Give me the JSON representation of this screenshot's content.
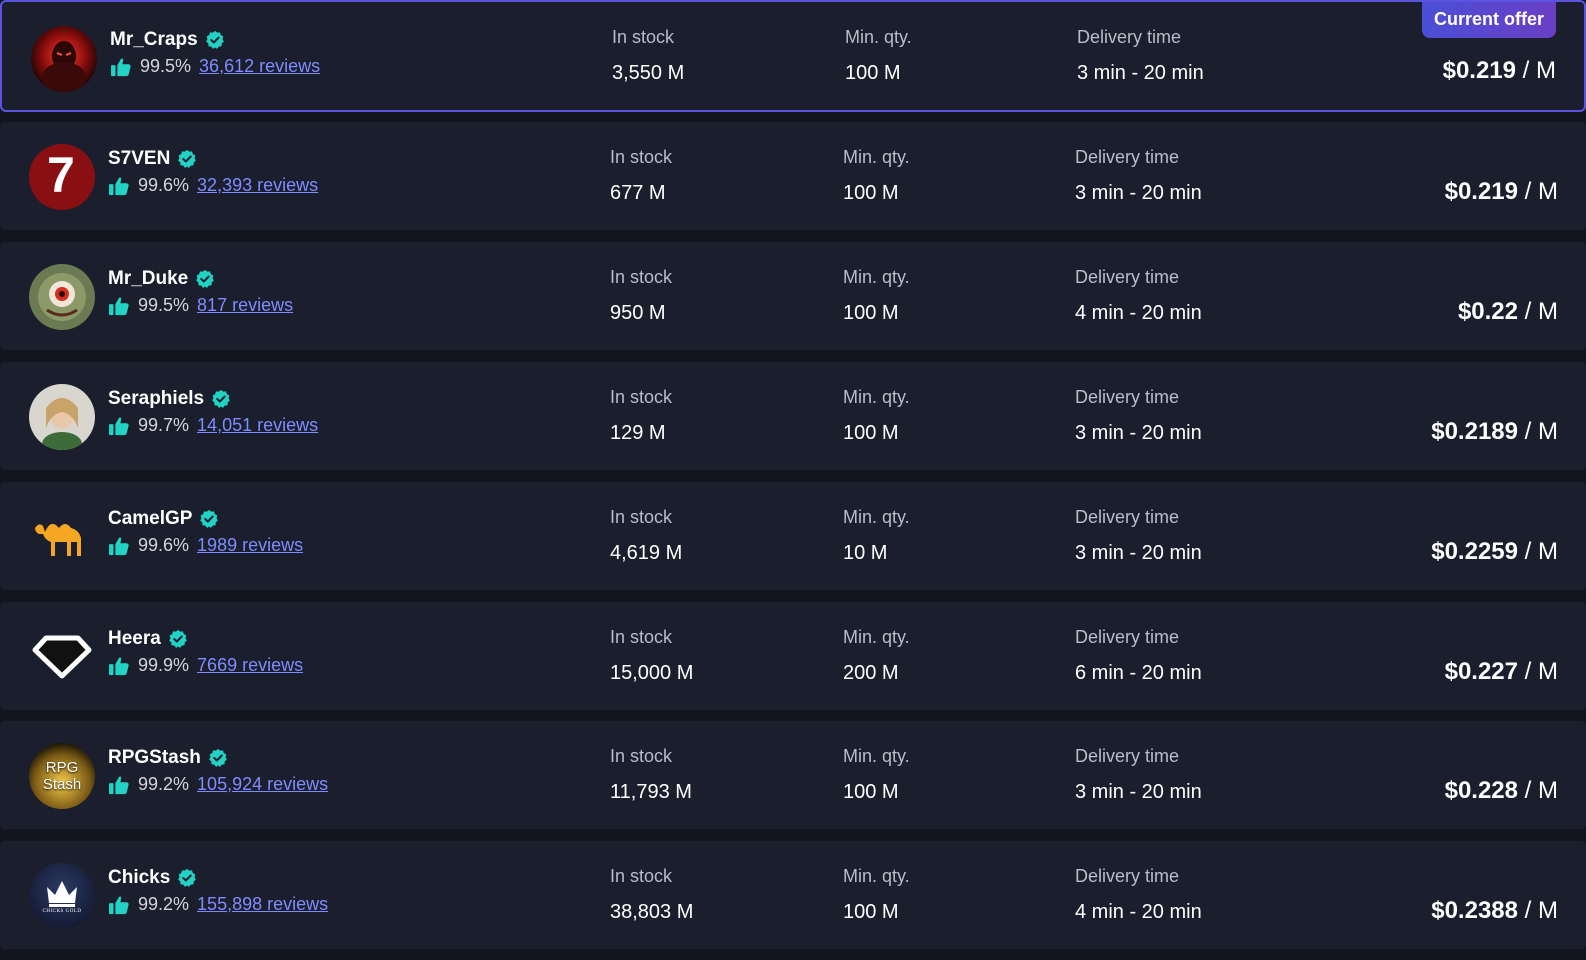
{
  "labels": {
    "in_stock": "In stock",
    "min_qty": "Min. qty.",
    "delivery_time": "Delivery time",
    "current_offer": "Current offer",
    "price_unit": "/ M"
  },
  "colors": {
    "accent": "#5b54e0",
    "verified": "#22d3c5",
    "link": "#7f8cff",
    "row_bg": "#1b1e2c",
    "page_bg": "#121420"
  },
  "offers": [
    {
      "name": "Mr_Craps",
      "rating": "99.5%",
      "reviews": "36,612 reviews",
      "stock": "3,550 M",
      "min_qty": "100 M",
      "delivery": "3 min - 20 min",
      "price": "$0.219",
      "current": true,
      "avatar_icon": "red-warrior-avatar"
    },
    {
      "name": "S7VEN",
      "rating": "99.6%",
      "reviews": "32,393 reviews",
      "stock": "677 M",
      "min_qty": "100 M",
      "delivery": "3 min - 20 min",
      "price": "$0.219",
      "current": false,
      "avatar_icon": "seven-logo",
      "avatar_text": "7"
    },
    {
      "name": "Mr_Duke",
      "rating": "99.5%",
      "reviews": "817 reviews",
      "stock": "950 M",
      "min_qty": "100 M",
      "delivery": "4 min - 20 min",
      "price": "$0.22",
      "current": false,
      "avatar_icon": "eye-monster-avatar"
    },
    {
      "name": "Seraphiels",
      "rating": "99.7%",
      "reviews": "14,051 reviews",
      "stock": "129 M",
      "min_qty": "100 M",
      "delivery": "3 min - 20 min",
      "price": "$0.2189",
      "current": false,
      "avatar_icon": "elf-avatar"
    },
    {
      "name": "CamelGP",
      "rating": "99.6%",
      "reviews": "1989 reviews",
      "stock": "4,619 M",
      "min_qty": "10 M",
      "delivery": "3 min - 20 min",
      "price": "$0.2259",
      "current": false,
      "avatar_icon": "camel-logo"
    },
    {
      "name": "Heera",
      "rating": "99.9%",
      "reviews": "7669 reviews",
      "stock": "15,000 M",
      "min_qty": "200 M",
      "delivery": "6 min - 20 min",
      "price": "$0.227",
      "current": false,
      "avatar_icon": "diamond-logo"
    },
    {
      "name": "RPGStash",
      "rating": "99.2%",
      "reviews": "105,924 reviews",
      "stock": "11,793 M",
      "min_qty": "100 M",
      "delivery": "3 min - 20 min",
      "price": "$0.228",
      "current": false,
      "avatar_icon": "rpgstash-logo",
      "avatar_text": "RPG Stash"
    },
    {
      "name": "Chicks",
      "rating": "99.2%",
      "reviews": "155,898 reviews",
      "stock": "38,803 M",
      "min_qty": "100 M",
      "delivery": "4 min - 20 min",
      "price": "$0.2388",
      "current": false,
      "avatar_icon": "crown-logo",
      "avatar_text": "CHICKS GOLD"
    }
  ]
}
